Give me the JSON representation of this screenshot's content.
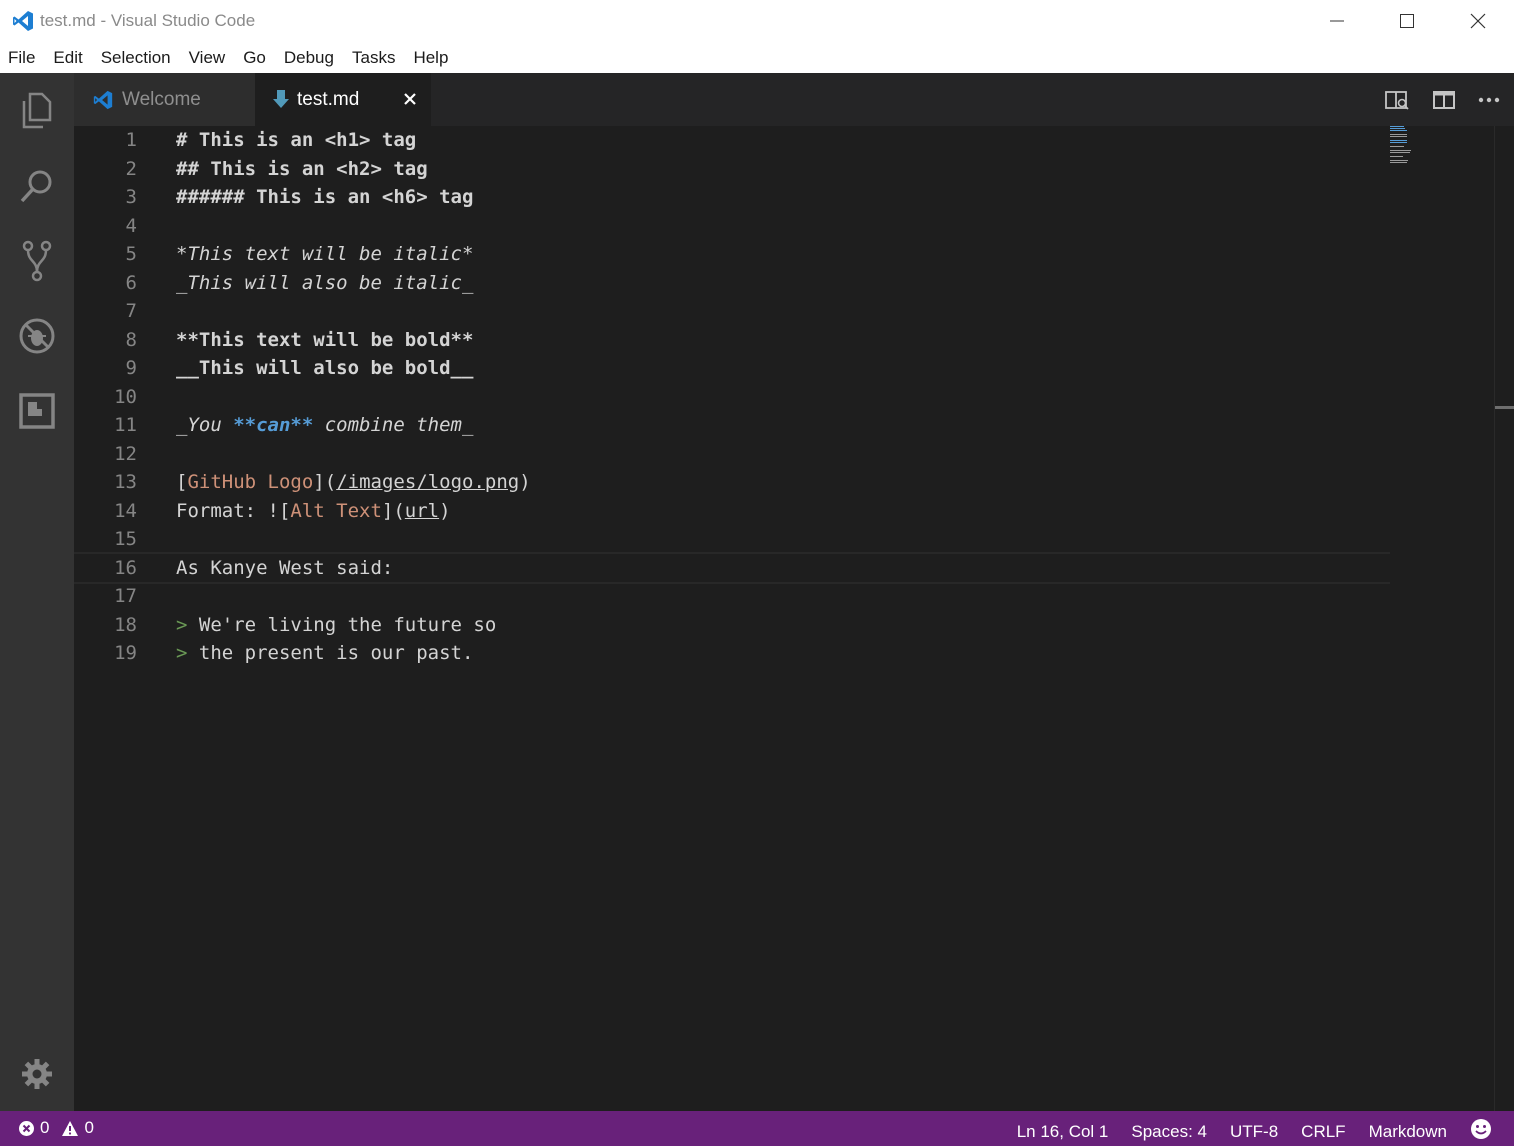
{
  "window": {
    "title_file": "test.md",
    "title_sep": " - ",
    "title_app": "Visual Studio Code"
  },
  "menu": [
    "File",
    "Edit",
    "Selection",
    "View",
    "Go",
    "Debug",
    "Tasks",
    "Help"
  ],
  "activity_bar": [
    "explorer-icon",
    "search-icon",
    "source-control-icon",
    "debug-icon",
    "extensions-icon",
    "settings-gear-icon"
  ],
  "tabs": [
    {
      "label": "Welcome",
      "icon": "vscode-icon",
      "active": false
    },
    {
      "label": "test.md",
      "icon": "markdown-download-icon",
      "active": true,
      "close": "×"
    }
  ],
  "editor": {
    "line_numbers": [
      "1",
      "2",
      "3",
      "4",
      "5",
      "6",
      "7",
      "8",
      "9",
      "10",
      "11",
      "12",
      "13",
      "14",
      "15",
      "16",
      "17",
      "18",
      "19"
    ],
    "lines": {
      "l1": "# This is an <h1> tag",
      "l2": "## This is an <h2> tag",
      "l3": "###### This is an <h6> tag",
      "l5": "*This text will be italic*",
      "l6": "_This will also be italic_",
      "l8": "**This text will be bold**",
      "l9": "__This will also be bold__",
      "l11": {
        "a": "_You ",
        "b": "**can**",
        "c": " combine them_"
      },
      "l13": {
        "a": "[",
        "b": "GitHub Logo",
        "c": "](",
        "d": "/images/logo.png",
        "e": ")"
      },
      "l14": {
        "a": "Format: ![",
        "b": "Alt Text",
        "c": "](",
        "d": "url",
        "e": ")"
      },
      "l16": "As Kanye West said:",
      "l18": {
        "mark": ">",
        "text": " We're living the future so"
      },
      "l19": {
        "mark": ">",
        "text": " the present is our past."
      }
    },
    "current_line": 16
  },
  "status": {
    "errors": "0",
    "warnings": "0",
    "position": "Ln 16, Col 1",
    "spaces": "Spaces: 4",
    "encoding": "UTF-8",
    "eol": "CRLF",
    "language": "Markdown"
  },
  "colors": {
    "status_bar": "#68217a",
    "activity_bar": "#333333",
    "editor_bg": "#1e1e1e",
    "heading": "#569cd6",
    "link_text": "#ce9178",
    "quote": "#6a9955"
  }
}
